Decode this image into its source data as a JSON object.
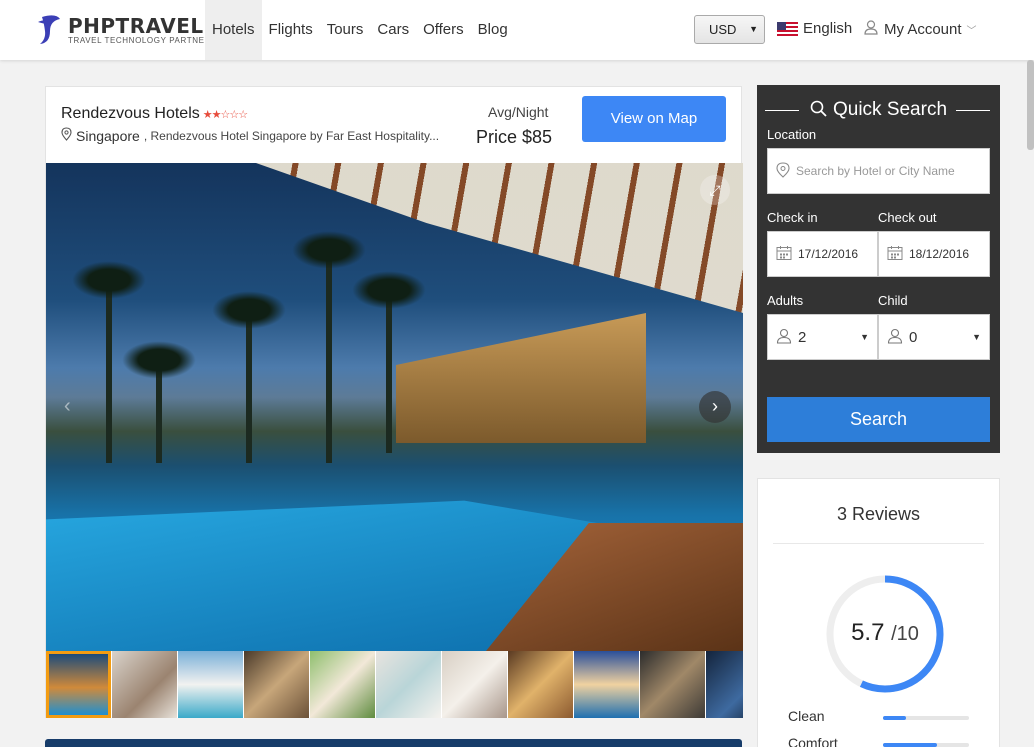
{
  "brand": {
    "name": "PHPTRAVELS",
    "tagline": "TRAVEL TECHNOLOGY PARTNER",
    "accent": "#3d87f5"
  },
  "nav": {
    "items": [
      {
        "label": "Hotels",
        "active": true
      },
      {
        "label": "Flights"
      },
      {
        "label": "Tours"
      },
      {
        "label": "Cars"
      },
      {
        "label": "Offers"
      },
      {
        "label": "Blog"
      }
    ],
    "currency": "USD",
    "language": "English",
    "account": "My Account"
  },
  "hotel": {
    "name": "Rendezvous Hotels",
    "stars": 2,
    "stars_max": 5,
    "city": "Singapore",
    "address": ", Rendezvous Hotel Singapore by Far East Hospitality...",
    "avg_label": "Avg/Night",
    "price_label": "Price $85",
    "map_button": "View on Map",
    "thumbnail_count": 11
  },
  "quick_search": {
    "title": "Quick Search",
    "location_label": "Location",
    "location_placeholder": "Search by Hotel or City Name",
    "checkin_label": "Check in",
    "checkin_value": "17/12/2016",
    "checkout_label": "Check out",
    "checkout_value": "18/12/2016",
    "adults_label": "Adults",
    "adults_value": "2",
    "child_label": "Child",
    "child_value": "0",
    "search_button": "Search"
  },
  "reviews": {
    "count": "3",
    "label": "Reviews",
    "score": "5.7",
    "score_of": "/10",
    "score_fraction": 0.57,
    "metrics": [
      {
        "label": "Clean",
        "value": 0.27
      },
      {
        "label": "Comfort",
        "value": 0.63
      }
    ]
  }
}
